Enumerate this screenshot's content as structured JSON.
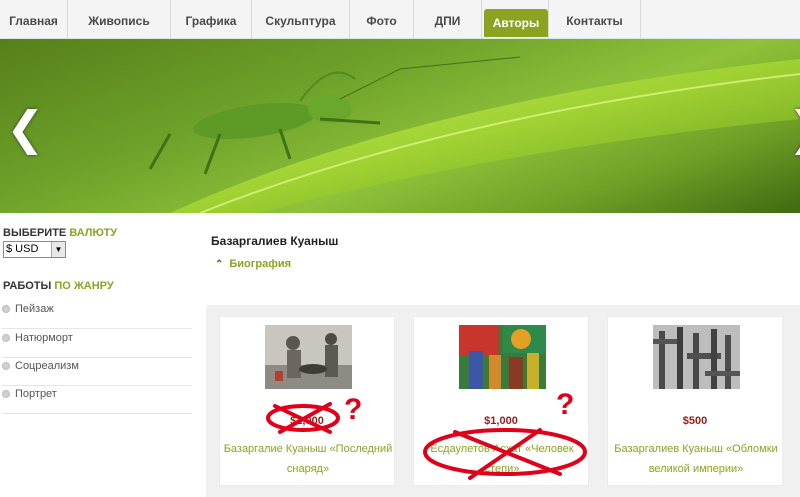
{
  "nav": {
    "items": [
      {
        "label": "Главная",
        "active": false
      },
      {
        "label": "Живопись",
        "active": false
      },
      {
        "label": "Графика",
        "active": false
      },
      {
        "label": "Скульптура",
        "active": false
      },
      {
        "label": "Фото",
        "active": false
      },
      {
        "label": "ДПИ",
        "active": false
      },
      {
        "label": "Авторы",
        "active": true
      },
      {
        "label": "Контакты",
        "active": false
      }
    ]
  },
  "banner": {
    "prev_label": "❮",
    "next_label": "❯"
  },
  "sidebar": {
    "currency_heading_main": "ВЫБЕРИТЕ ",
    "currency_heading_accent": "ВАЛЮТУ",
    "currency_value": "$ USD",
    "works_heading_main": "РАБОТЫ ",
    "works_heading_accent": "ПО ЖАНРУ",
    "genres": [
      {
        "label": "Пейзаж"
      },
      {
        "label": "Натюрморт"
      },
      {
        "label": "Соцреализм"
      },
      {
        "label": "Портрет"
      }
    ]
  },
  "main": {
    "author_name": "Базаргалиев Куаныш",
    "bio_label": "Биография",
    "works": [
      {
        "price": "$2,000",
        "title": "Базаргалие Куаныш «Последний снаряд»"
      },
      {
        "price": "$1,000",
        "title": "Есдаулетов Асхат «Человек степи»"
      },
      {
        "price": "$500",
        "title": "Базаргалиев Куаныш «Обломки великой империи»"
      }
    ],
    "annotation_mark": "?"
  },
  "colors": {
    "accent": "#8ca321",
    "price": "#9b1c1c",
    "annotation": "#e0001a"
  }
}
